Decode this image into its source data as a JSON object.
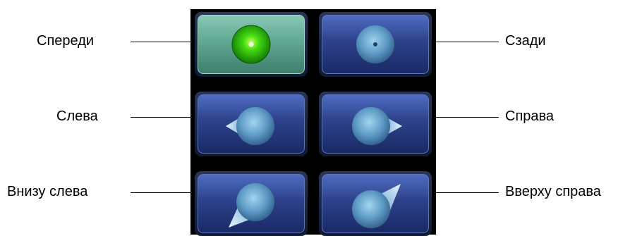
{
  "labels": {
    "front": "Спереди",
    "back": "Сзади",
    "left": "Слева",
    "right": "Справа",
    "bottom_left": "Внизу слева",
    "top_right": "Вверху справа"
  },
  "selected": "front",
  "colors": {
    "panel_background": "#000000",
    "button_blue": "#2d418a",
    "button_active_green": "#5aa08c",
    "indicator_green": "#33cc11"
  }
}
